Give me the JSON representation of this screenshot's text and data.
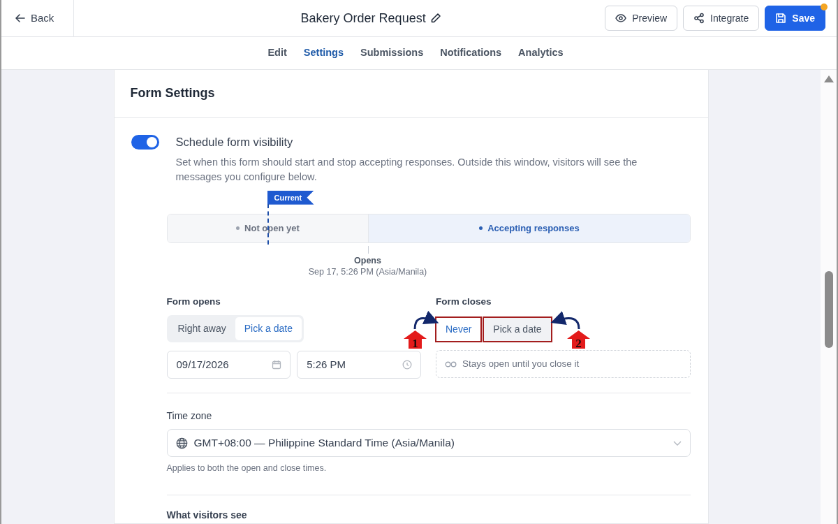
{
  "header": {
    "back": "Back",
    "title": "Bakery Order Request",
    "buttons": [
      {
        "label": "Preview",
        "kind": "preview",
        "unsaved": false
      },
      {
        "label": "Integrate",
        "kind": "integrate",
        "unsaved": false
      },
      {
        "label": "Save",
        "kind": "save",
        "unsaved": true
      }
    ]
  },
  "tabs": [
    {
      "label": "Edit",
      "selected": false
    },
    {
      "label": "Settings",
      "selected": true
    },
    {
      "label": "Submissions",
      "selected": false
    },
    {
      "label": "Notifications",
      "selected": false
    },
    {
      "label": "Analytics",
      "selected": false
    }
  ],
  "card": {
    "title": "Form Settings"
  },
  "schedule": {
    "on": true,
    "title": "Schedule form visibility",
    "description": "Set when this form should start and stop accepting responses. Outside this window, visitors will see the messages you configure below."
  },
  "timeline": {
    "marker": "Current",
    "segments": [
      {
        "label": "Not open yet",
        "active": false
      },
      {
        "label": "Accepting responses",
        "active": true
      }
    ],
    "event_label": "Opens",
    "event_time": "Sep 17, 5:26 PM (Asia/Manila)"
  },
  "form_opens": {
    "label": "Form opens",
    "options": [
      {
        "label": "Right away",
        "selected": false,
        "highlighted": false
      },
      {
        "label": "Pick a date",
        "selected": true,
        "highlighted": false
      }
    ],
    "date": "09/17/2026",
    "time": "5:26 PM"
  },
  "form_closes": {
    "label": "Form closes",
    "options": [
      {
        "label": "Never",
        "selected": true,
        "highlighted": true
      },
      {
        "label": "Pick a date",
        "selected": false,
        "highlighted": true
      }
    ],
    "status": "Stays open until you close it"
  },
  "annotations": [
    {
      "number": "1"
    },
    {
      "number": "2"
    }
  ],
  "time_zone": {
    "label": "Time zone",
    "value": "GMT+08:00 — Philippine Standard Time (Asia/Manila)",
    "help": "Applies to both the open and close times."
  },
  "visitors": {
    "title": "What visitors see"
  }
}
